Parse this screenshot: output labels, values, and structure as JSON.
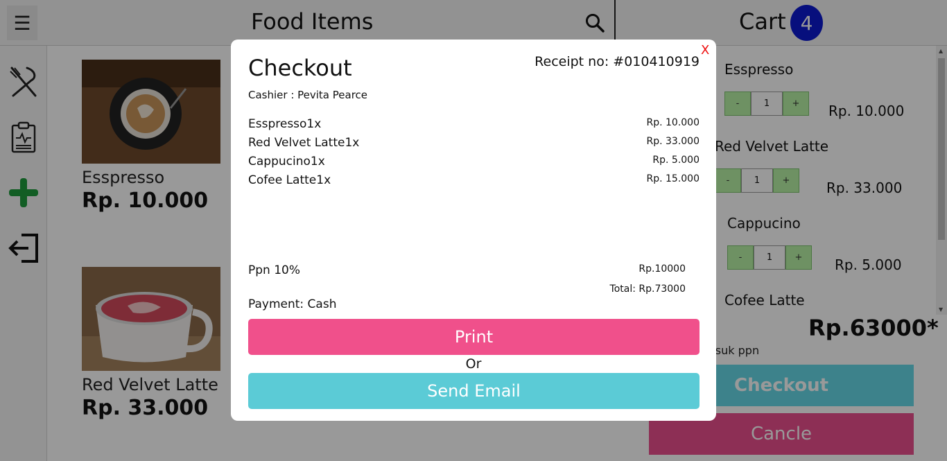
{
  "header": {
    "menu_icon": "hamburger-icon",
    "food_title": "Food Items",
    "search_icon": "search-icon",
    "cart_title": "Cart",
    "cart_count": "4",
    "badge_color": "#0d1ad1"
  },
  "sidebar": {
    "items": [
      {
        "icon": "fork-knife-icon"
      },
      {
        "icon": "clipboard-icon"
      },
      {
        "icon": "plus-icon",
        "color": "#1e9b3c"
      },
      {
        "icon": "logout-icon"
      }
    ]
  },
  "food_items": [
    {
      "name": "Esspresso",
      "price": "Rp. 10.000"
    },
    {
      "name": "Red Velvet Latte",
      "price": "Rp. 33.000"
    }
  ],
  "cart": {
    "items": [
      {
        "name": "Esspresso",
        "qty": "1",
        "minus": "-",
        "plus": "+",
        "price": "Rp. 10.000"
      },
      {
        "name": "Red Velvet Latte",
        "qty": "1",
        "minus": "-",
        "plus": "+",
        "price": "Rp. 33.000"
      },
      {
        "name": "Cappucino",
        "qty": "1",
        "minus": "-",
        "plus": "+",
        "price": "Rp. 5.000"
      },
      {
        "name": "Cofee Latte"
      }
    ],
    "total": "Rp.63000*",
    "ppn_note": "asuk ppn",
    "checkout_label": "Checkout",
    "cancel_label": "Cancle"
  },
  "modal": {
    "close_label": "X",
    "title": "Checkout",
    "receipt_no": "Receipt no: #010410919",
    "cashier": "Cashier : Pevita Pearce",
    "lines": [
      {
        "name": "Esspresso1x",
        "price": "Rp. 10.000"
      },
      {
        "name": "Red Velvet Latte1x",
        "price": "Rp. 33.000"
      },
      {
        "name": "Cappucino1x",
        "price": "Rp. 5.000"
      },
      {
        "name": "Cofee Latte1x",
        "price": "Rp. 15.000"
      }
    ],
    "ppn_label": "Ppn 10%",
    "ppn_value": "Rp.10000",
    "total": "Total: Rp.73000",
    "payment": "Payment: Cash",
    "print_label": "Print",
    "or_label": "Or",
    "email_label": "Send Email",
    "print_color": "#f0508b",
    "email_color": "#5bcbd6"
  }
}
